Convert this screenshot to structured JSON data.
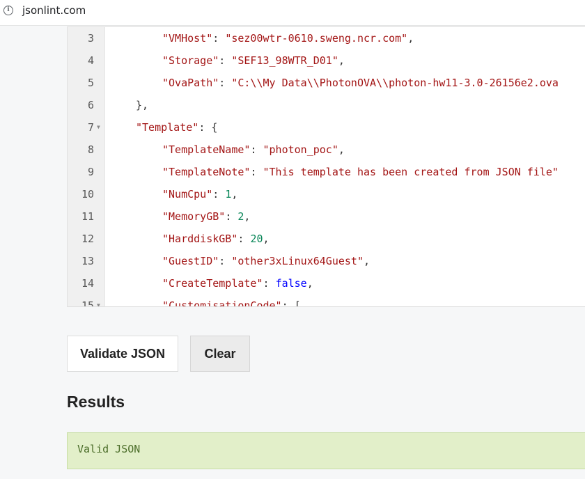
{
  "browser": {
    "url": "jsonlint.com"
  },
  "editor": {
    "lines": [
      {
        "num": "3",
        "fold": "",
        "indent": 2,
        "key": "\"VMHost\"",
        "sep": ": ",
        "val": "\"sez00wtr-0610.sweng.ncr.com\"",
        "vtype": "s",
        "tail": ","
      },
      {
        "num": "4",
        "fold": "",
        "indent": 2,
        "key": "\"Storage\"",
        "sep": ": ",
        "val": "\"SEF13_98WTR_D01\"",
        "vtype": "s",
        "tail": ","
      },
      {
        "num": "5",
        "fold": "",
        "indent": 2,
        "key": "\"OvaPath\"",
        "sep": ": ",
        "val": "\"C:\\\\My Data\\\\PhotonOVA\\\\photon-hw11-3.0-26156e2.ova",
        "vtype": "s",
        "tail": ""
      },
      {
        "num": "6",
        "fold": "",
        "indent": 1,
        "key": "",
        "sep": "",
        "val": "",
        "vtype": "",
        "tail": "},"
      },
      {
        "num": "7",
        "fold": "▼",
        "indent": 1,
        "key": "\"Template\"",
        "sep": ": ",
        "val": "",
        "vtype": "",
        "tail": "{"
      },
      {
        "num": "8",
        "fold": "",
        "indent": 2,
        "key": "\"TemplateName\"",
        "sep": ": ",
        "val": "\"photon_poc\"",
        "vtype": "s",
        "tail": ","
      },
      {
        "num": "9",
        "fold": "",
        "indent": 2,
        "key": "\"TemplateNote\"",
        "sep": ": ",
        "val": "\"This template has been created from JSON file\"",
        "vtype": "s",
        "tail": ""
      },
      {
        "num": "10",
        "fold": "",
        "indent": 2,
        "key": "\"NumCpu\"",
        "sep": ": ",
        "val": "1",
        "vtype": "n",
        "tail": ","
      },
      {
        "num": "11",
        "fold": "",
        "indent": 2,
        "key": "\"MemoryGB\"",
        "sep": ": ",
        "val": "2",
        "vtype": "n",
        "tail": ","
      },
      {
        "num": "12",
        "fold": "",
        "indent": 2,
        "key": "\"HarddiskGB\"",
        "sep": ": ",
        "val": "20",
        "vtype": "n",
        "tail": ","
      },
      {
        "num": "13",
        "fold": "",
        "indent": 2,
        "key": "\"GuestID\"",
        "sep": ": ",
        "val": "\"other3xLinux64Guest\"",
        "vtype": "s",
        "tail": ","
      },
      {
        "num": "14",
        "fold": "",
        "indent": 2,
        "key": "\"CreateTemplate\"",
        "sep": ": ",
        "val": "false",
        "vtype": "b",
        "tail": ","
      },
      {
        "num": "15",
        "fold": "▼",
        "indent": 2,
        "key": "\"CustomisationCode\"",
        "sep": ": ",
        "val": "",
        "vtype": "",
        "tail": "["
      }
    ]
  },
  "buttons": {
    "validate": "Validate JSON",
    "clear": "Clear"
  },
  "results": {
    "title": "Results",
    "message": "Valid JSON"
  }
}
